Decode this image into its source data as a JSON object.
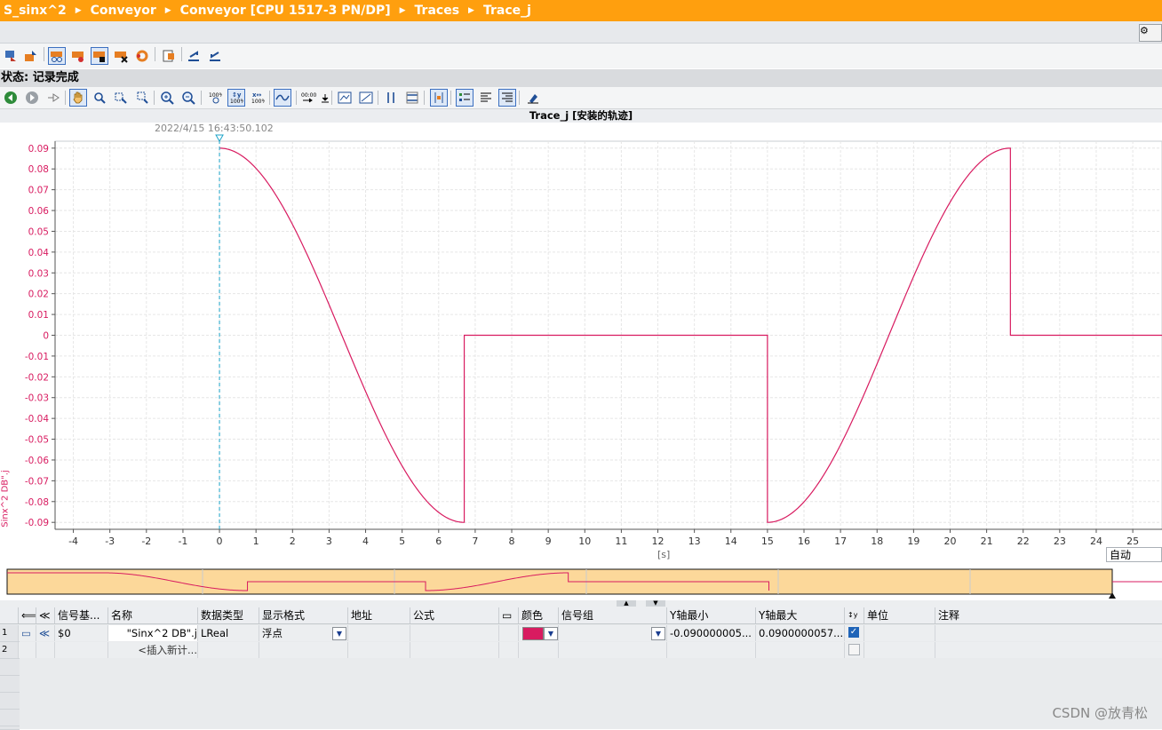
{
  "breadcrumb": [
    "S_sinx^2",
    "Conveyor",
    "Conveyor [CPU 1517-3 PN/DP]",
    "Traces",
    "Trace_j"
  ],
  "status": {
    "label": "状态: 记录完成"
  },
  "chart_title": "Trace_j [安装的轨迹]",
  "cursor_timestamp": "2022/4/15 16:43:50.102",
  "x_unit_label": "[s]",
  "auto_select": "自动",
  "signal_color": "#d81b60",
  "overview_fill": "#fcd89a",
  "chart_data": {
    "type": "line",
    "xlim": [
      -4.5,
      25.8
    ],
    "ylim": [
      -0.09,
      0.09
    ],
    "x_ticks": [
      -4,
      -3,
      -2,
      -1,
      0,
      1,
      2,
      3,
      4,
      5,
      6,
      7,
      8,
      9,
      10,
      11,
      12,
      13,
      14,
      15,
      16,
      17,
      18,
      19,
      20,
      21,
      22,
      23,
      24,
      25
    ],
    "y_ticks": [
      0.09,
      0.08,
      0.07,
      0.06,
      0.05,
      0.04,
      0.03,
      0.02,
      0.01,
      0,
      -0.01,
      -0.02,
      -0.03,
      -0.04,
      -0.05,
      -0.06,
      -0.07,
      -0.08,
      -0.09
    ],
    "y_tick_labels": [
      "0.09",
      "0.08",
      "0.07",
      "0.06",
      "0.05",
      "0.04",
      "0.03",
      "0.02",
      "0.01",
      "0",
      "-0.01",
      "-0.02",
      "-0.03",
      "-0.04",
      "-0.05",
      "-0.06",
      "-0.07",
      "-0.08",
      "-0.09"
    ],
    "ylabel": "Sinx^2 DB\".j",
    "cursor_x": 0,
    "series": [
      {
        "name": "\"Sinx^2 DB\".j",
        "segments": [
          {
            "shape": "cos",
            "x0": 0,
            "x1": 6.7,
            "from": 0.09,
            "to": -0.09
          },
          {
            "shape": "step",
            "points": [
              [
                6.7,
                -0.09
              ],
              [
                6.7,
                0
              ],
              [
                15.0,
                0
              ],
              [
                15.0,
                -0.09
              ]
            ]
          },
          {
            "shape": "cos",
            "x0": 15.0,
            "x1": 21.65,
            "from": -0.09,
            "to": 0.09
          },
          {
            "shape": "step",
            "points": [
              [
                21.65,
                0.09
              ],
              [
                21.65,
                0
              ],
              [
                25.8,
                0
              ]
            ]
          }
        ]
      }
    ]
  },
  "table": {
    "headers": [
      "信号基...",
      "名称",
      "数据类型",
      "显示格式",
      "地址",
      "公式",
      "颜色",
      "信号组",
      "Y轴最小",
      "Y轴最大",
      "单位",
      "注释"
    ],
    "rows": [
      {
        "num": "1",
        "signal": "$0",
        "name": "\"Sinx^2 DB\".j",
        "dtype": "LReal",
        "format": "浮点",
        "ymin": "-0.090000005...",
        "ymax": "0.0900000057...",
        "checked": true
      },
      {
        "num": "2",
        "signal": "",
        "name": "<插入新计...",
        "dtype": "",
        "format": "",
        "ymin": "",
        "ymax": "",
        "checked": false
      }
    ]
  },
  "watermark": "CSDN @放青松"
}
